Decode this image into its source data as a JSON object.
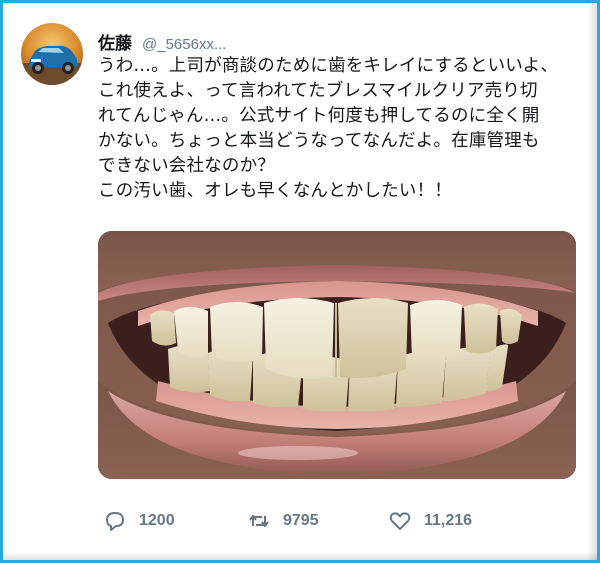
{
  "tweet": {
    "display_name": "佐藤",
    "handle": "@_5656xx...",
    "text": "うわ…。上司が商談のために歯をキレイにするといいよ、\nこれ使えよ、って言われてたブレスマイルクリア売り切\nれてんじゃん…。公式サイト何度も押してるのに全く開\nかない。ちょっと本当どうなってなんだよ。在庫管理も\nできない会社なのか？\nこの汚い歯、オレも早くなんとかしたい！！"
  },
  "actions": {
    "reply_count": "1200",
    "retweet_count": "9795",
    "like_count": "11,216"
  },
  "icons": {
    "reply": "speech-bubble-icon",
    "retweet": "retweet-arrows-icon",
    "like": "heart-outline-icon"
  },
  "colors": {
    "border": "#29a9e1",
    "text": "#14171a",
    "muted": "#657786"
  }
}
